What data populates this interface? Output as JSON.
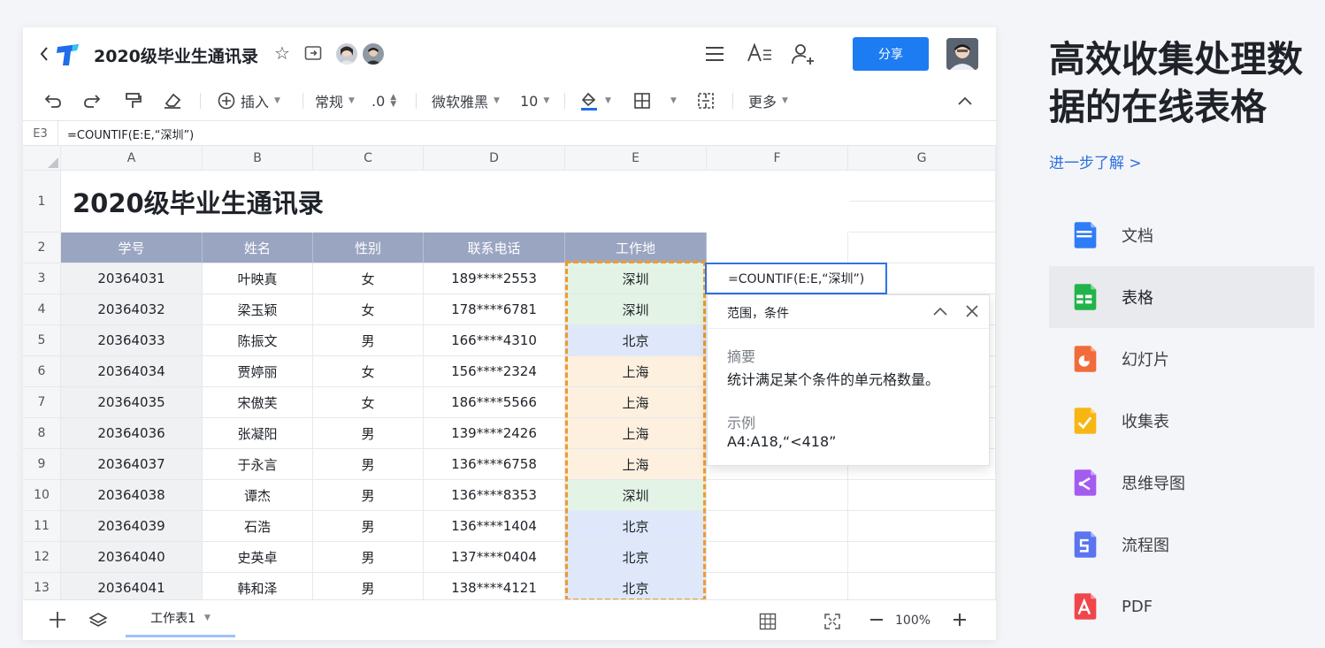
{
  "doc": {
    "title": "2020级毕业生通讯录",
    "share_label": "分享"
  },
  "toolbar": {
    "insert": "插入",
    "format": "常规",
    "decimal": ".0",
    "font": "微软雅黑",
    "size": "10",
    "more": "更多"
  },
  "formula_bar": {
    "cell_ref": "E3",
    "formula": "=COUNTIF(E:E,“深圳”)"
  },
  "grid": {
    "columns": [
      "A",
      "B",
      "C",
      "D",
      "E",
      "F",
      "G"
    ],
    "sheet_title": "2020级毕业生通讯录",
    "headers": [
      "学号",
      "姓名",
      "性别",
      "联系电话",
      "工作地"
    ],
    "rows": [
      {
        "row": "3",
        "id": "20364031",
        "name": "叶映真",
        "gender": "女",
        "phone": "189****2553",
        "city": "深圳"
      },
      {
        "row": "4",
        "id": "20364032",
        "name": "梁玉颖",
        "gender": "女",
        "phone": "178****6781",
        "city": "深圳"
      },
      {
        "row": "5",
        "id": "20364033",
        "name": "陈振文",
        "gender": "男",
        "phone": "166****4310",
        "city": "北京"
      },
      {
        "row": "6",
        "id": "20364034",
        "name": "贾婷丽",
        "gender": "女",
        "phone": "156****2324",
        "city": "上海"
      },
      {
        "row": "7",
        "id": "20364035",
        "name": "宋傲芙",
        "gender": "女",
        "phone": "186****5566",
        "city": "上海"
      },
      {
        "row": "8",
        "id": "20364036",
        "name": "张凝阳",
        "gender": "男",
        "phone": "139****2426",
        "city": "上海"
      },
      {
        "row": "9",
        "id": "20364037",
        "name": "于永言",
        "gender": "男",
        "phone": "136****6758",
        "city": "上海"
      },
      {
        "row": "10",
        "id": "20364038",
        "name": "谭杰",
        "gender": "男",
        "phone": "136****8353",
        "city": "深圳"
      },
      {
        "row": "11",
        "id": "20364039",
        "name": "石浩",
        "gender": "男",
        "phone": "136****1404",
        "city": "北京"
      },
      {
        "row": "12",
        "id": "20364040",
        "name": "史英卓",
        "gender": "男",
        "phone": "137****0404",
        "city": "北京"
      },
      {
        "row": "13",
        "id": "20364041",
        "name": "韩和泽",
        "gender": "男",
        "phone": "138****4121",
        "city": "北京"
      }
    ],
    "editing_cell_text": "=COUNTIF(E:E,“深圳”)",
    "city_colors": {
      "深圳": "#e3f3e6",
      "北京": "#dfe8fb",
      "上海": "#fdf0de"
    }
  },
  "formula_popup": {
    "args": "范围，条件",
    "summary_label": "摘要",
    "summary": "统计满足某个条件的单元格数量。",
    "example_label": "示例",
    "example": "A4:A18,“<418”"
  },
  "bottom_bar": {
    "sheet_tab": "工作表1",
    "zoom": "100%"
  },
  "right_panel": {
    "headline_line1": "高效收集处理数",
    "headline_line2": "据的在线表格",
    "learn_more": "进一步了解 >",
    "products": [
      {
        "label": "文档",
        "icon": "doc-icon",
        "color": "#2f7df6",
        "active": false
      },
      {
        "label": "表格",
        "icon": "sheet-icon",
        "color": "#22b34a",
        "active": true
      },
      {
        "label": "幻灯片",
        "icon": "slides-icon",
        "color": "#f26b3a",
        "active": false
      },
      {
        "label": "收集表",
        "icon": "form-icon",
        "color": "#f7b614",
        "active": false
      },
      {
        "label": "思维导图",
        "icon": "mindmap-icon",
        "color": "#a35cf0",
        "active": false
      },
      {
        "label": "流程图",
        "icon": "flowchart-icon",
        "color": "#5b74f0",
        "active": false
      },
      {
        "label": "PDF",
        "icon": "pdf-icon",
        "color": "#f0464b",
        "active": false
      }
    ]
  }
}
